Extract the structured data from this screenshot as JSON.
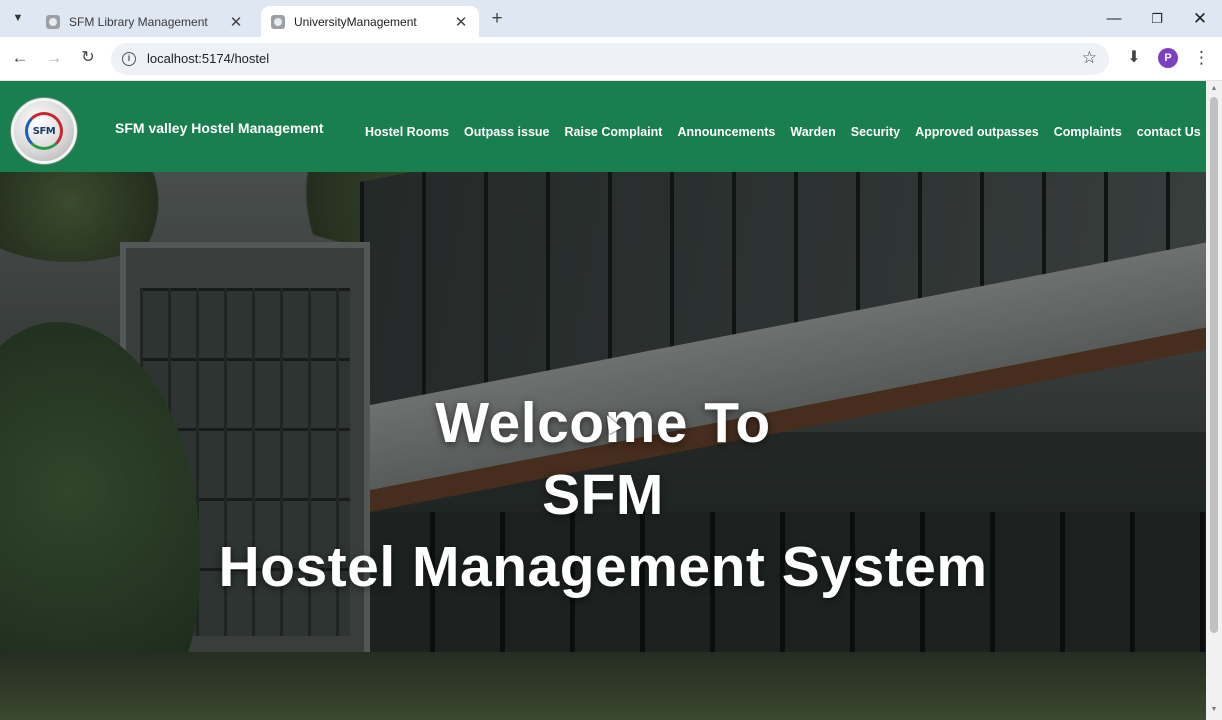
{
  "browser": {
    "tabs": [
      {
        "title": "SFM Library Management",
        "active": false
      },
      {
        "title": "UniversityManagement",
        "active": true
      }
    ],
    "url": "localhost:5174/hostel",
    "profile_initial": "P"
  },
  "navbar": {
    "logo_text": "SFM",
    "title": "SFM valley Hostel Management",
    "links": [
      "Hostel Rooms",
      "Outpass issue",
      "Raise Complaint",
      "Announcements",
      "Warden",
      "Security",
      "Approved outpasses",
      "Complaints",
      "contact Us"
    ]
  },
  "hero": {
    "line1": "Welcome To",
    "line2": "SFM",
    "line3": "Hostel Management System"
  },
  "colors": {
    "navbar_bg": "#1a7f4e",
    "hero_text": "#ffffff"
  }
}
